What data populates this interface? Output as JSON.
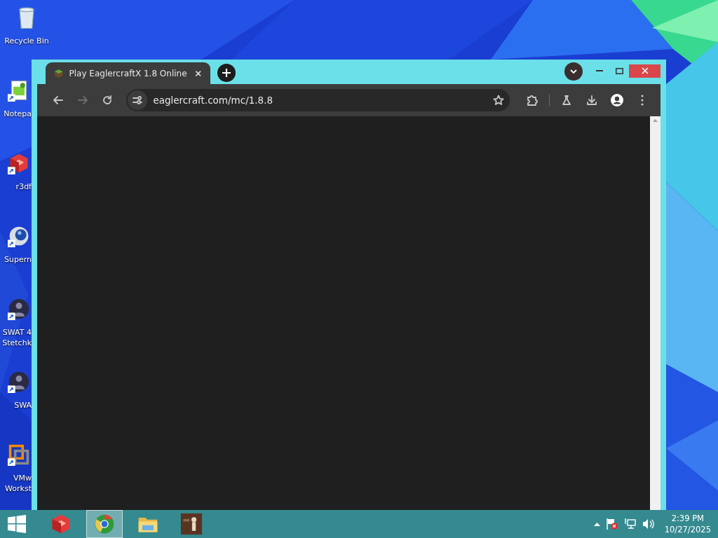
{
  "desktop_icons": [
    {
      "kind": "recycle-bin",
      "shortcut": false,
      "lines": [
        "Recycle Bin"
      ]
    },
    {
      "kind": "notepad",
      "shortcut": true,
      "lines": [
        "Notepa"
      ]
    },
    {
      "kind": "red-cube",
      "shortcut": true,
      "lines": [
        "r3df"
      ]
    },
    {
      "kind": "sphere",
      "shortcut": true,
      "lines": [
        "Supern"
      ]
    },
    {
      "kind": "game",
      "shortcut": true,
      "lines": [
        "SWAT 4",
        "Stetchk"
      ]
    },
    {
      "kind": "game",
      "shortcut": true,
      "lines": [
        "SWA"
      ]
    },
    {
      "kind": "vm",
      "shortcut": true,
      "lines": [
        "VMw",
        "Workst"
      ]
    }
  ],
  "browser": {
    "tabs": [
      {
        "title": "Play EaglercraftX 1.8 Online",
        "selected": true
      }
    ],
    "address": "eaglercraft.com/mc/1.8.8",
    "forward_disabled": true
  },
  "taskbar": {
    "apps": [
      {
        "kind": "red-cube",
        "active": false
      },
      {
        "kind": "browser",
        "active": true
      },
      {
        "kind": "folder",
        "active": false
      },
      {
        "kind": "picture",
        "active": false
      }
    ],
    "time": "2:39 PM",
    "date": "10/27/2025"
  }
}
